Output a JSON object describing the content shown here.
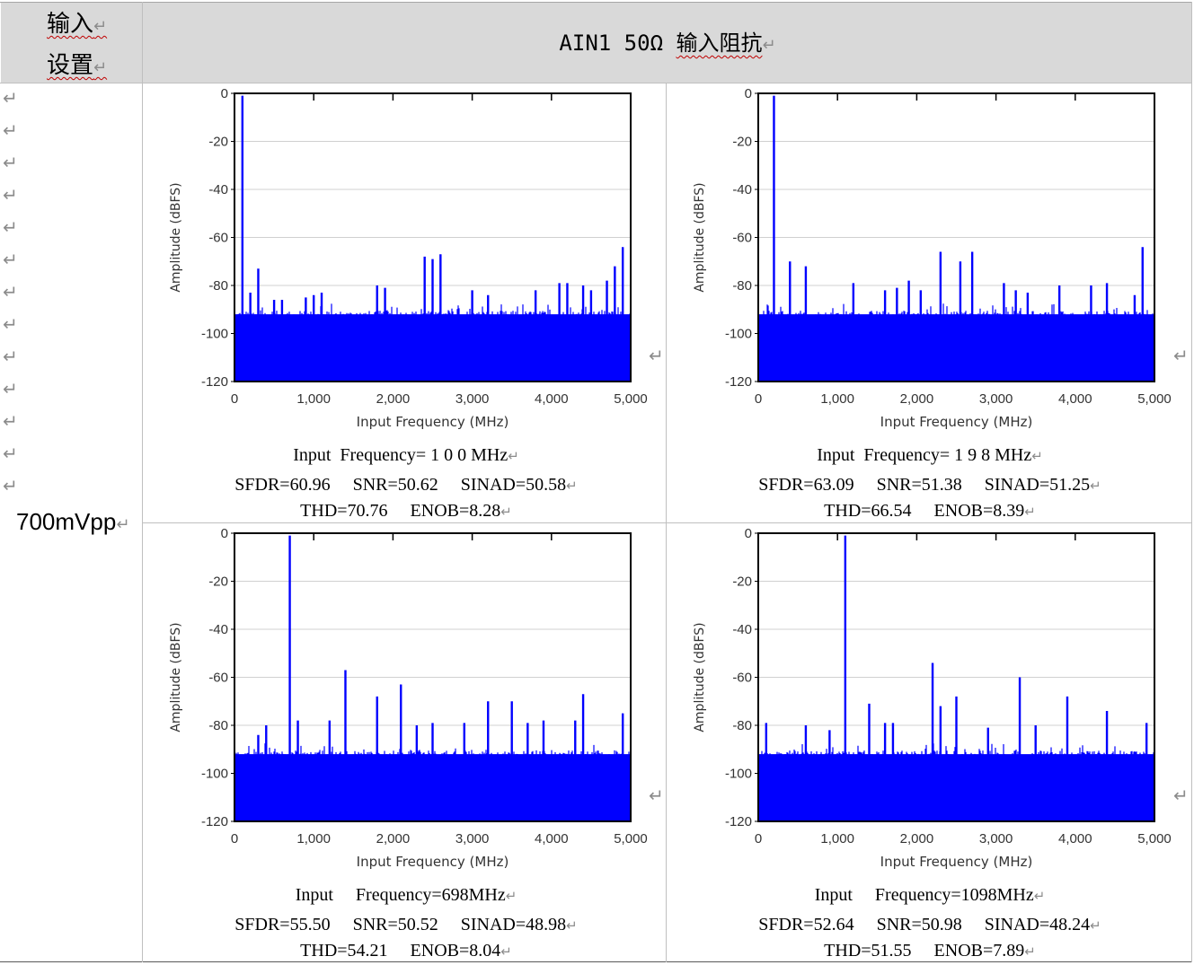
{
  "header": {
    "setting_line1": "输入",
    "setting_line2": "设置",
    "title_prefix": "AIN1 50Ω ",
    "title_cn": "输入阻抗",
    "return_mark": "↵"
  },
  "row_label": "700mVpp",
  "axis": {
    "ylabel": "Amplitude (dBFS)",
    "xlabel": "Input Frequency (MHz)",
    "yticks": [
      "0",
      "-20",
      "-40",
      "-60",
      "-80",
      "-100",
      "-120"
    ],
    "xticks": [
      "0",
      "1,000",
      "2,000",
      "3,000",
      "4,000",
      "5,000"
    ]
  },
  "panels": [
    {
      "caption_freq": "Input  Frequency= 1 0 0 MHz",
      "caption_metrics": "SFDR=60.96     SNR=50.62     SINAD=50.58",
      "caption_thd": "THD=70.76     ENOB=8.28"
    },
    {
      "caption_freq": "Input  Frequency= 1 9 8 MHz",
      "caption_metrics": "SFDR=63.09     SNR=51.38     SINAD=51.25",
      "caption_thd": "THD=66.54     ENOB=8.39"
    },
    {
      "caption_freq": "Input     Frequency=698MHz",
      "caption_metrics": "SFDR=55.50     SNR=50.52     SINAD=48.98",
      "caption_thd": "THD=54.21     ENOB=8.04"
    },
    {
      "caption_freq": "Input     Frequency=1098MHz",
      "caption_metrics": "SFDR=52.64     SNR=50.98     SINAD=48.24",
      "caption_thd": "THD=51.55     ENOB=7.89"
    }
  ],
  "chart_data": [
    {
      "type": "bar",
      "xlabel": "Input Frequency (MHz)",
      "ylabel": "Amplitude (dBFS)",
      "xlim": [
        0,
        5000
      ],
      "ylim": [
        -120,
        0
      ],
      "noise_floor_dbfs": -93,
      "series_color": "#0000ff",
      "spurs": [
        {
          "x": 100,
          "y": -1
        },
        {
          "x": 200,
          "y": -83
        },
        {
          "x": 300,
          "y": -73
        },
        {
          "x": 500,
          "y": -86
        },
        {
          "x": 600,
          "y": -86
        },
        {
          "x": 900,
          "y": -85
        },
        {
          "x": 1000,
          "y": -84
        },
        {
          "x": 1100,
          "y": -83
        },
        {
          "x": 1800,
          "y": -80
        },
        {
          "x": 1900,
          "y": -81
        },
        {
          "x": 2400,
          "y": -68
        },
        {
          "x": 2500,
          "y": -69
        },
        {
          "x": 2600,
          "y": -67
        },
        {
          "x": 3000,
          "y": -82
        },
        {
          "x": 3200,
          "y": -84
        },
        {
          "x": 3800,
          "y": -82
        },
        {
          "x": 4100,
          "y": -79
        },
        {
          "x": 4200,
          "y": -79
        },
        {
          "x": 4400,
          "y": -80
        },
        {
          "x": 4500,
          "y": -82
        },
        {
          "x": 4700,
          "y": -78
        },
        {
          "x": 4800,
          "y": -72
        },
        {
          "x": 4900,
          "y": -64
        }
      ]
    },
    {
      "type": "bar",
      "xlabel": "Input Frequency (MHz)",
      "ylabel": "Amplitude (dBFS)",
      "xlim": [
        0,
        5000
      ],
      "ylim": [
        -120,
        0
      ],
      "noise_floor_dbfs": -93,
      "series_color": "#0000ff",
      "spurs": [
        {
          "x": 198,
          "y": -1
        },
        {
          "x": 400,
          "y": -70
        },
        {
          "x": 600,
          "y": -72
        },
        {
          "x": 1200,
          "y": -79
        },
        {
          "x": 1600,
          "y": -82
        },
        {
          "x": 1750,
          "y": -81
        },
        {
          "x": 1900,
          "y": -78
        },
        {
          "x": 2050,
          "y": -82
        },
        {
          "x": 2300,
          "y": -66
        },
        {
          "x": 2550,
          "y": -70
        },
        {
          "x": 2700,
          "y": -66
        },
        {
          "x": 3100,
          "y": -79
        },
        {
          "x": 3250,
          "y": -82
        },
        {
          "x": 3400,
          "y": -83
        },
        {
          "x": 3800,
          "y": -80
        },
        {
          "x": 4200,
          "y": -80
        },
        {
          "x": 4400,
          "y": -79
        },
        {
          "x": 4750,
          "y": -84
        },
        {
          "x": 4850,
          "y": -64
        }
      ]
    },
    {
      "type": "bar",
      "xlabel": "Input Frequency (MHz)",
      "ylabel": "Amplitude (dBFS)",
      "xlim": [
        0,
        5000
      ],
      "ylim": [
        -120,
        0
      ],
      "noise_floor_dbfs": -93,
      "series_color": "#0000ff",
      "spurs": [
        {
          "x": 300,
          "y": -84
        },
        {
          "x": 400,
          "y": -80
        },
        {
          "x": 698,
          "y": -1
        },
        {
          "x": 800,
          "y": -78
        },
        {
          "x": 1200,
          "y": -78
        },
        {
          "x": 1400,
          "y": -57
        },
        {
          "x": 1800,
          "y": -68
        },
        {
          "x": 2100,
          "y": -63
        },
        {
          "x": 2300,
          "y": -80
        },
        {
          "x": 2500,
          "y": -79
        },
        {
          "x": 2900,
          "y": -79
        },
        {
          "x": 3200,
          "y": -70
        },
        {
          "x": 3500,
          "y": -70
        },
        {
          "x": 3700,
          "y": -79
        },
        {
          "x": 3900,
          "y": -78
        },
        {
          "x": 4300,
          "y": -78
        },
        {
          "x": 4400,
          "y": -67
        },
        {
          "x": 4900,
          "y": -75
        }
      ]
    },
    {
      "type": "bar",
      "xlabel": "Input Frequency (MHz)",
      "ylabel": "Amplitude (dBFS)",
      "xlim": [
        0,
        5000
      ],
      "ylim": [
        -120,
        0
      ],
      "noise_floor_dbfs": -93,
      "series_color": "#0000ff",
      "spurs": [
        {
          "x": 100,
          "y": -79
        },
        {
          "x": 600,
          "y": -80
        },
        {
          "x": 900,
          "y": -82
        },
        {
          "x": 1098,
          "y": -1
        },
        {
          "x": 1400,
          "y": -71
        },
        {
          "x": 1600,
          "y": -79
        },
        {
          "x": 1700,
          "y": -79
        },
        {
          "x": 2200,
          "y": -54
        },
        {
          "x": 2300,
          "y": -72
        },
        {
          "x": 2500,
          "y": -68
        },
        {
          "x": 2900,
          "y": -81
        },
        {
          "x": 3300,
          "y": -60
        },
        {
          "x": 3500,
          "y": -80
        },
        {
          "x": 3900,
          "y": -68
        },
        {
          "x": 4400,
          "y": -74
        },
        {
          "x": 4900,
          "y": -79
        }
      ]
    }
  ]
}
